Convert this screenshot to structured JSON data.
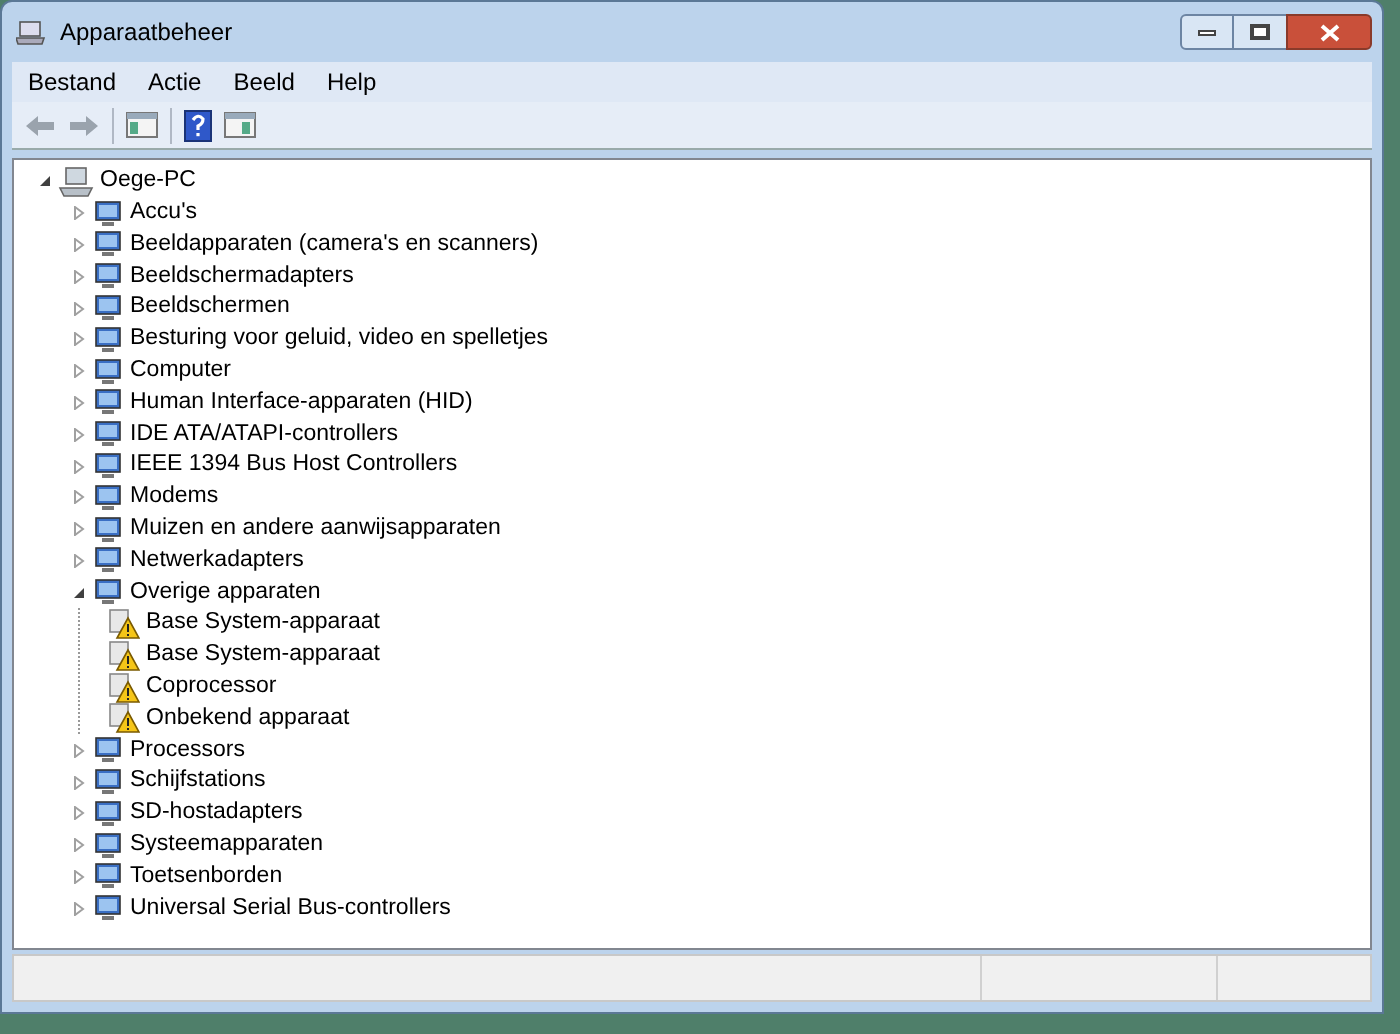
{
  "window": {
    "title": "Apparaatbeheer"
  },
  "menu": [
    "Bestand",
    "Actie",
    "Beeld",
    "Help"
  ],
  "tree": {
    "label": "Oege-PC",
    "expanded": true,
    "children": [
      {
        "label": "Accu's",
        "expanded": false
      },
      {
        "label": "Beeldapparaten (camera's en scanners)",
        "expanded": false
      },
      {
        "label": "Beeldschermadapters",
        "expanded": false
      },
      {
        "label": "Beeldschermen",
        "expanded": false
      },
      {
        "label": "Besturing voor geluid, video en spelletjes",
        "expanded": false
      },
      {
        "label": "Computer",
        "expanded": false
      },
      {
        "label": "Human Interface-apparaten (HID)",
        "expanded": false
      },
      {
        "label": "IDE ATA/ATAPI-controllers",
        "expanded": false
      },
      {
        "label": "IEEE 1394 Bus Host Controllers",
        "expanded": false
      },
      {
        "label": "Modems",
        "expanded": false
      },
      {
        "label": "Muizen en andere aanwijsapparaten",
        "expanded": false
      },
      {
        "label": "Netwerkadapters",
        "expanded": false
      },
      {
        "label": "Overige apparaten",
        "expanded": true,
        "children": [
          {
            "label": "Base System-apparaat"
          },
          {
            "label": "Base System-apparaat"
          },
          {
            "label": "Coprocessor"
          },
          {
            "label": "Onbekend apparaat"
          }
        ]
      },
      {
        "label": "Processors",
        "expanded": false
      },
      {
        "label": "Schijfstations",
        "expanded": false
      },
      {
        "label": "SD-hostadapters",
        "expanded": false
      },
      {
        "label": "Systeemapparaten",
        "expanded": false
      },
      {
        "label": "Toetsenborden",
        "expanded": false
      },
      {
        "label": "Universal Serial Bus-controllers",
        "expanded": false
      }
    ]
  }
}
